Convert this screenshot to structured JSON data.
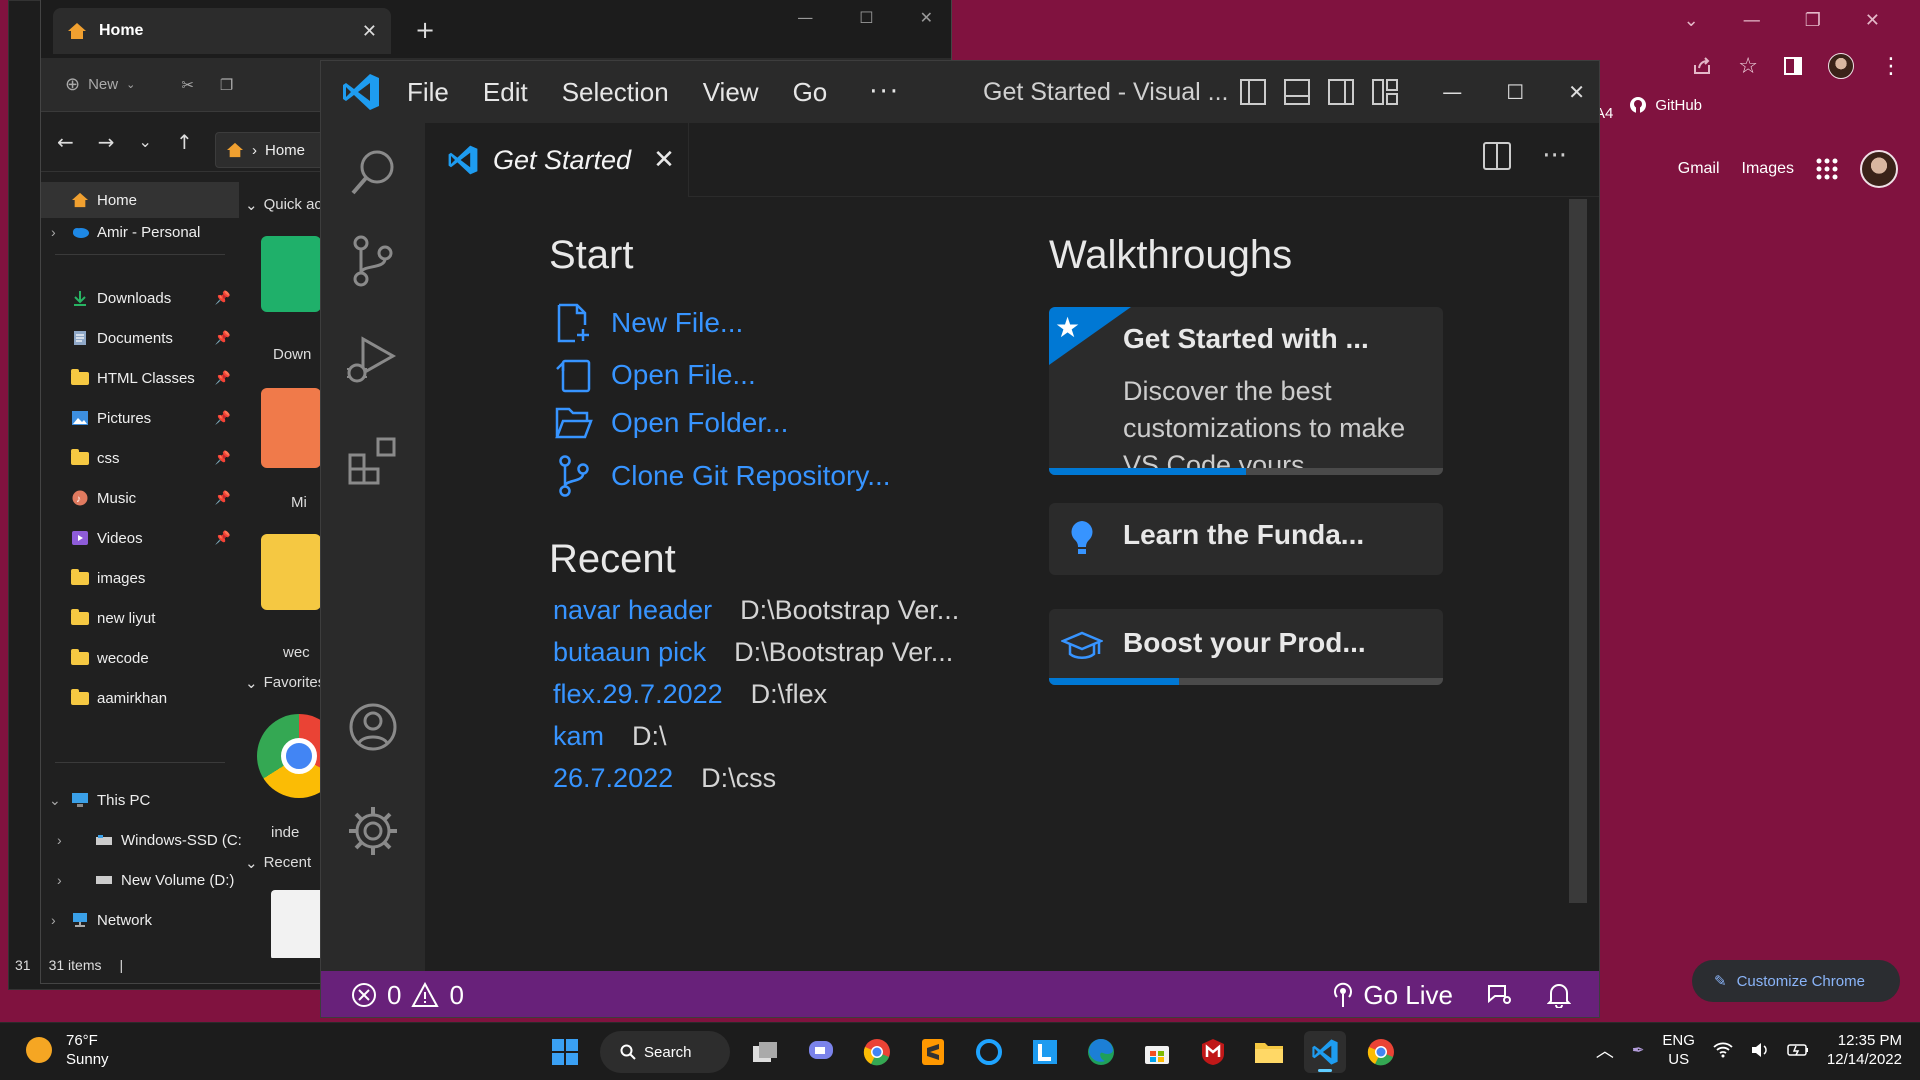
{
  "chrome": {
    "bookmarks": [
      {
        "label": "- A4"
      },
      {
        "label": "GitHub"
      }
    ],
    "more_bookmarks": "»",
    "ntp_links": {
      "gmail": "Gmail",
      "images": "Images"
    },
    "customize_label": "Customize Chrome"
  },
  "explorer": {
    "tab_title": "Home",
    "new_label": "New",
    "breadcrumb": "Home",
    "nav_items": [
      {
        "label": "Home"
      },
      {
        "label": "Amir - Personal"
      },
      {
        "label": "Downloads"
      },
      {
        "label": "Documents"
      },
      {
        "label": "HTML Classes"
      },
      {
        "label": "Pictures"
      },
      {
        "label": "css"
      },
      {
        "label": "Music"
      },
      {
        "label": "Videos"
      },
      {
        "label": "images"
      },
      {
        "label": "new liyut"
      },
      {
        "label": "wecode"
      },
      {
        "label": "aamirkhan"
      },
      {
        "label": "This PC"
      },
      {
        "label": "Windows-SSD (C:"
      },
      {
        "label": "New Volume (D:)"
      },
      {
        "label": "Network"
      }
    ],
    "content_groups": {
      "quick_access": "Quick ac",
      "favorites": "Favorites",
      "recent": "Recent"
    },
    "content_labels": [
      "Down",
      "Mi",
      "wec",
      "inde"
    ],
    "status_left": "31",
    "status": "31 items"
  },
  "vscode": {
    "menu": [
      "File",
      "Edit",
      "Selection",
      "View",
      "Go"
    ],
    "more": "···",
    "window_title": "Get Started - Visual ...",
    "tab_label": "Get Started",
    "start_heading": "Start",
    "start_links": [
      {
        "label": "New File..."
      },
      {
        "label": "Open File..."
      },
      {
        "label": "Open Folder..."
      },
      {
        "label": "Clone Git Repository..."
      }
    ],
    "recent_heading": "Recent",
    "recent": [
      {
        "name": "navar header",
        "path": "D:\\Bootstrap Ver..."
      },
      {
        "name": "butaaun pick",
        "path": "D:\\Bootstrap Ver..."
      },
      {
        "name": "flex.29.7.2022",
        "path": "D:\\flex"
      },
      {
        "name": "kam",
        "path": "D:\\"
      },
      {
        "name": "26.7.2022",
        "path": "D:\\css"
      }
    ],
    "walkthroughs_heading": "Walkthroughs",
    "walkthroughs": [
      {
        "title": "Get Started with ...",
        "description": "Discover the best customizations to make VS Code yours.",
        "progress": 0.5,
        "featured": true,
        "icon": "star-icon"
      },
      {
        "title": "Learn the Funda...",
        "progress": 0,
        "icon": "lightbulb-icon"
      },
      {
        "title": "Boost your Prod...",
        "progress": 0.33,
        "icon": "mortarboard-icon"
      }
    ],
    "status": {
      "errors": "0",
      "warnings": "0",
      "go_live": "Go Live"
    },
    "colors": {
      "accent": "#3794ff",
      "statusbar": "#68217a",
      "progress": "#0078d4"
    }
  },
  "taskbar": {
    "temperature": "76°F",
    "condition": "Sunny",
    "search_label": "Search",
    "lang": "ENG",
    "region": "US",
    "time": "12:35 PM",
    "date": "12/14/2022"
  }
}
